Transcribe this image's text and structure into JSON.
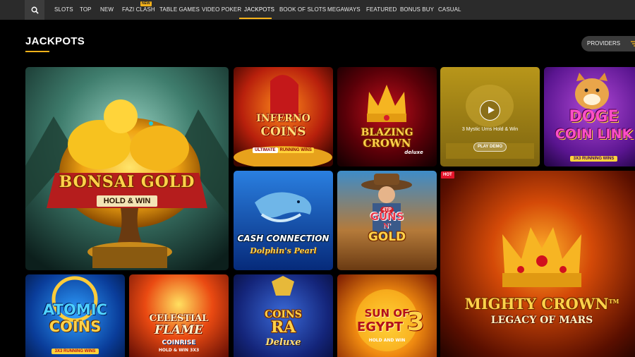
{
  "nav": {
    "search_icon": "search-icon",
    "items": [
      "SLOTS",
      "TOP",
      "NEW",
      "FAZI CLASH",
      "TABLE GAMES",
      "VIDEO POKER",
      "JACKPOTS",
      "BOOK OF SLOTS",
      "MEGAWAYS",
      "FEATURED",
      "BONUS BUY",
      "CASUAL"
    ],
    "active": "JACKPOTS",
    "new_badge": "NEW",
    "accent_color": "#f6b21a"
  },
  "section": {
    "title": "JACKPOTS",
    "providers_label": "PROVIDERS",
    "filter_icon": "filter-icon"
  },
  "games": {
    "bonsai": {
      "line1": "BONSAI GOLD",
      "line2": "HOLD & WIN"
    },
    "inferno": {
      "line1": "INFERNO",
      "line2": "COINS",
      "tag_a": "ULTIMATE",
      "tag_b": "RUNNING WINS"
    },
    "blazing": {
      "line1": "BLAZING",
      "line2": "CROWN",
      "tag": "deluxe"
    },
    "urns": {
      "name": "3 Mystic Urns Hold & Win",
      "demo_label": "PLAY DEMO",
      "play_icon": "play-icon"
    },
    "doge": {
      "line1": "DOGE",
      "line2": "COIN LINK",
      "tag": "3X3 RUNNING WINS"
    },
    "dolphin": {
      "line1": "CASH CONNECTION",
      "line2": "Dolphin's Pearl"
    },
    "guns": {
      "badge": "4TP",
      "line1": "GUNS",
      "line2": "N'",
      "line3": "GOLD"
    },
    "mighty": {
      "hot": "HOT",
      "line1": "MIGHTY CROWN",
      "tm": "TM",
      "line2": "LEGACY OF MARS"
    },
    "atomic": {
      "line1": "ATOMIC",
      "line2": "COINS",
      "tag": "3X3 RUNNING WINS"
    },
    "celestial": {
      "line1": "CELESTIAL",
      "line2": "FLAME",
      "line3": "COINRISE",
      "line4": "HOLD & WIN 3X3"
    },
    "ra": {
      "line1": "COINS",
      "line2": "RA",
      "line3": "Deluxe"
    },
    "egypt": {
      "line1": "SUN OF",
      "line2": "EGYPT",
      "num": "3",
      "line3": "HOLD AND WIN"
    }
  }
}
